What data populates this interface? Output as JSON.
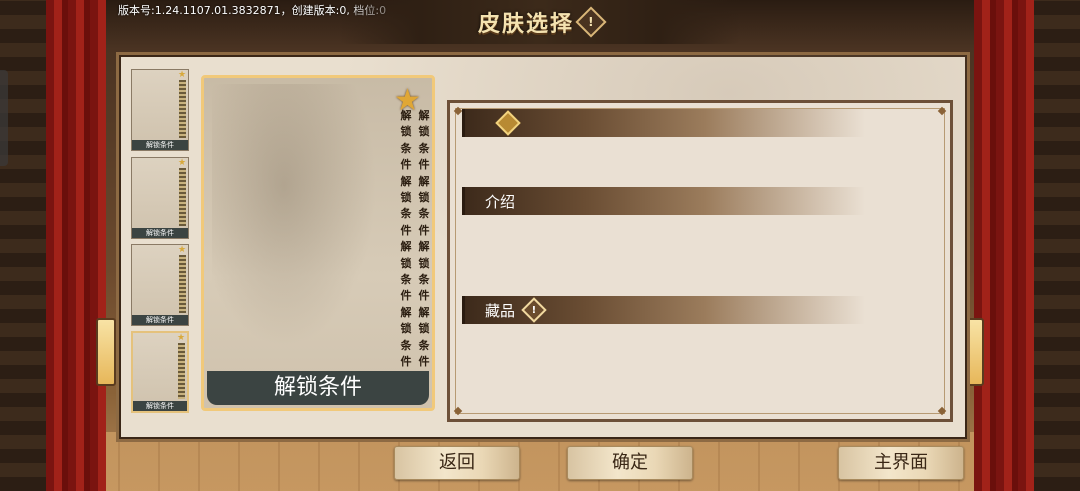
{
  "version_text": "版本号:1.24.1107.01.3832871，创建版本:0, 档位:0",
  "title": "皮肤选择",
  "thumbnails": [
    {
      "caption": "解锁条件"
    },
    {
      "caption": "解锁条件"
    },
    {
      "caption": "解锁条件"
    },
    {
      "caption": "解锁条件"
    }
  ],
  "card": {
    "caption": "解锁条件",
    "col_left": [
      "解",
      "锁",
      "条",
      "件",
      "解",
      "锁",
      "条",
      "件",
      "解",
      "锁",
      "条",
      "件",
      "解",
      "锁",
      "条",
      "件"
    ],
    "col_right": [
      "解",
      "锁",
      "条",
      "件",
      "解",
      "锁",
      "条",
      "件",
      "解",
      "锁",
      "条",
      "件",
      "解",
      "锁",
      "条",
      "件"
    ]
  },
  "info": {
    "intro_label": "介绍",
    "collection_label": "藏品"
  },
  "buttons": {
    "back": "返回",
    "confirm": "确定",
    "main": "主界面"
  },
  "icons": {
    "title_warn": "!",
    "collection_warn": "!",
    "star": "★"
  }
}
